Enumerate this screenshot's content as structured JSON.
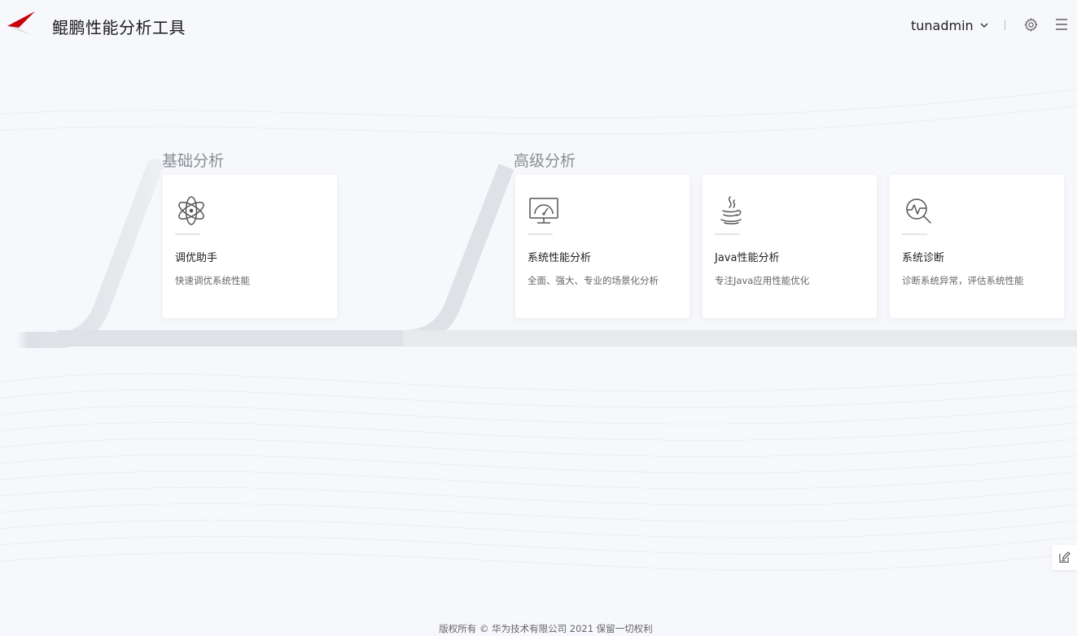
{
  "header": {
    "title": "鲲鹏性能分析工具",
    "user": "tunadmin",
    "logo_color": "#c7000b",
    "icons": {
      "user_menu": "chevron-down-icon",
      "settings": "gear-icon",
      "menu": "hamburger-menu-icon"
    }
  },
  "sections": {
    "basic": {
      "title": "基础分析",
      "cards": [
        {
          "title": "调优助手",
          "desc": "快速调优系统性能",
          "icon": "atom-icon"
        }
      ]
    },
    "advanced": {
      "title": "高级分析",
      "cards": [
        {
          "title": "系统性能分析",
          "desc": "全面、强大、专业的场景化分析",
          "icon": "monitor-gauge-icon"
        },
        {
          "title": "Java性能分析",
          "desc": "专注Java应用性能优化",
          "icon": "java-cup-icon"
        },
        {
          "title": "系统诊断",
          "desc": "诊断系统异常，评估系统性能",
          "icon": "diagnosis-magnifier-icon"
        }
      ]
    }
  },
  "feedback": {
    "icon": "edit-note-icon"
  },
  "footer": {
    "copyright": "版权所有 © 华为技术有限公司 2021 保留一切权利"
  }
}
